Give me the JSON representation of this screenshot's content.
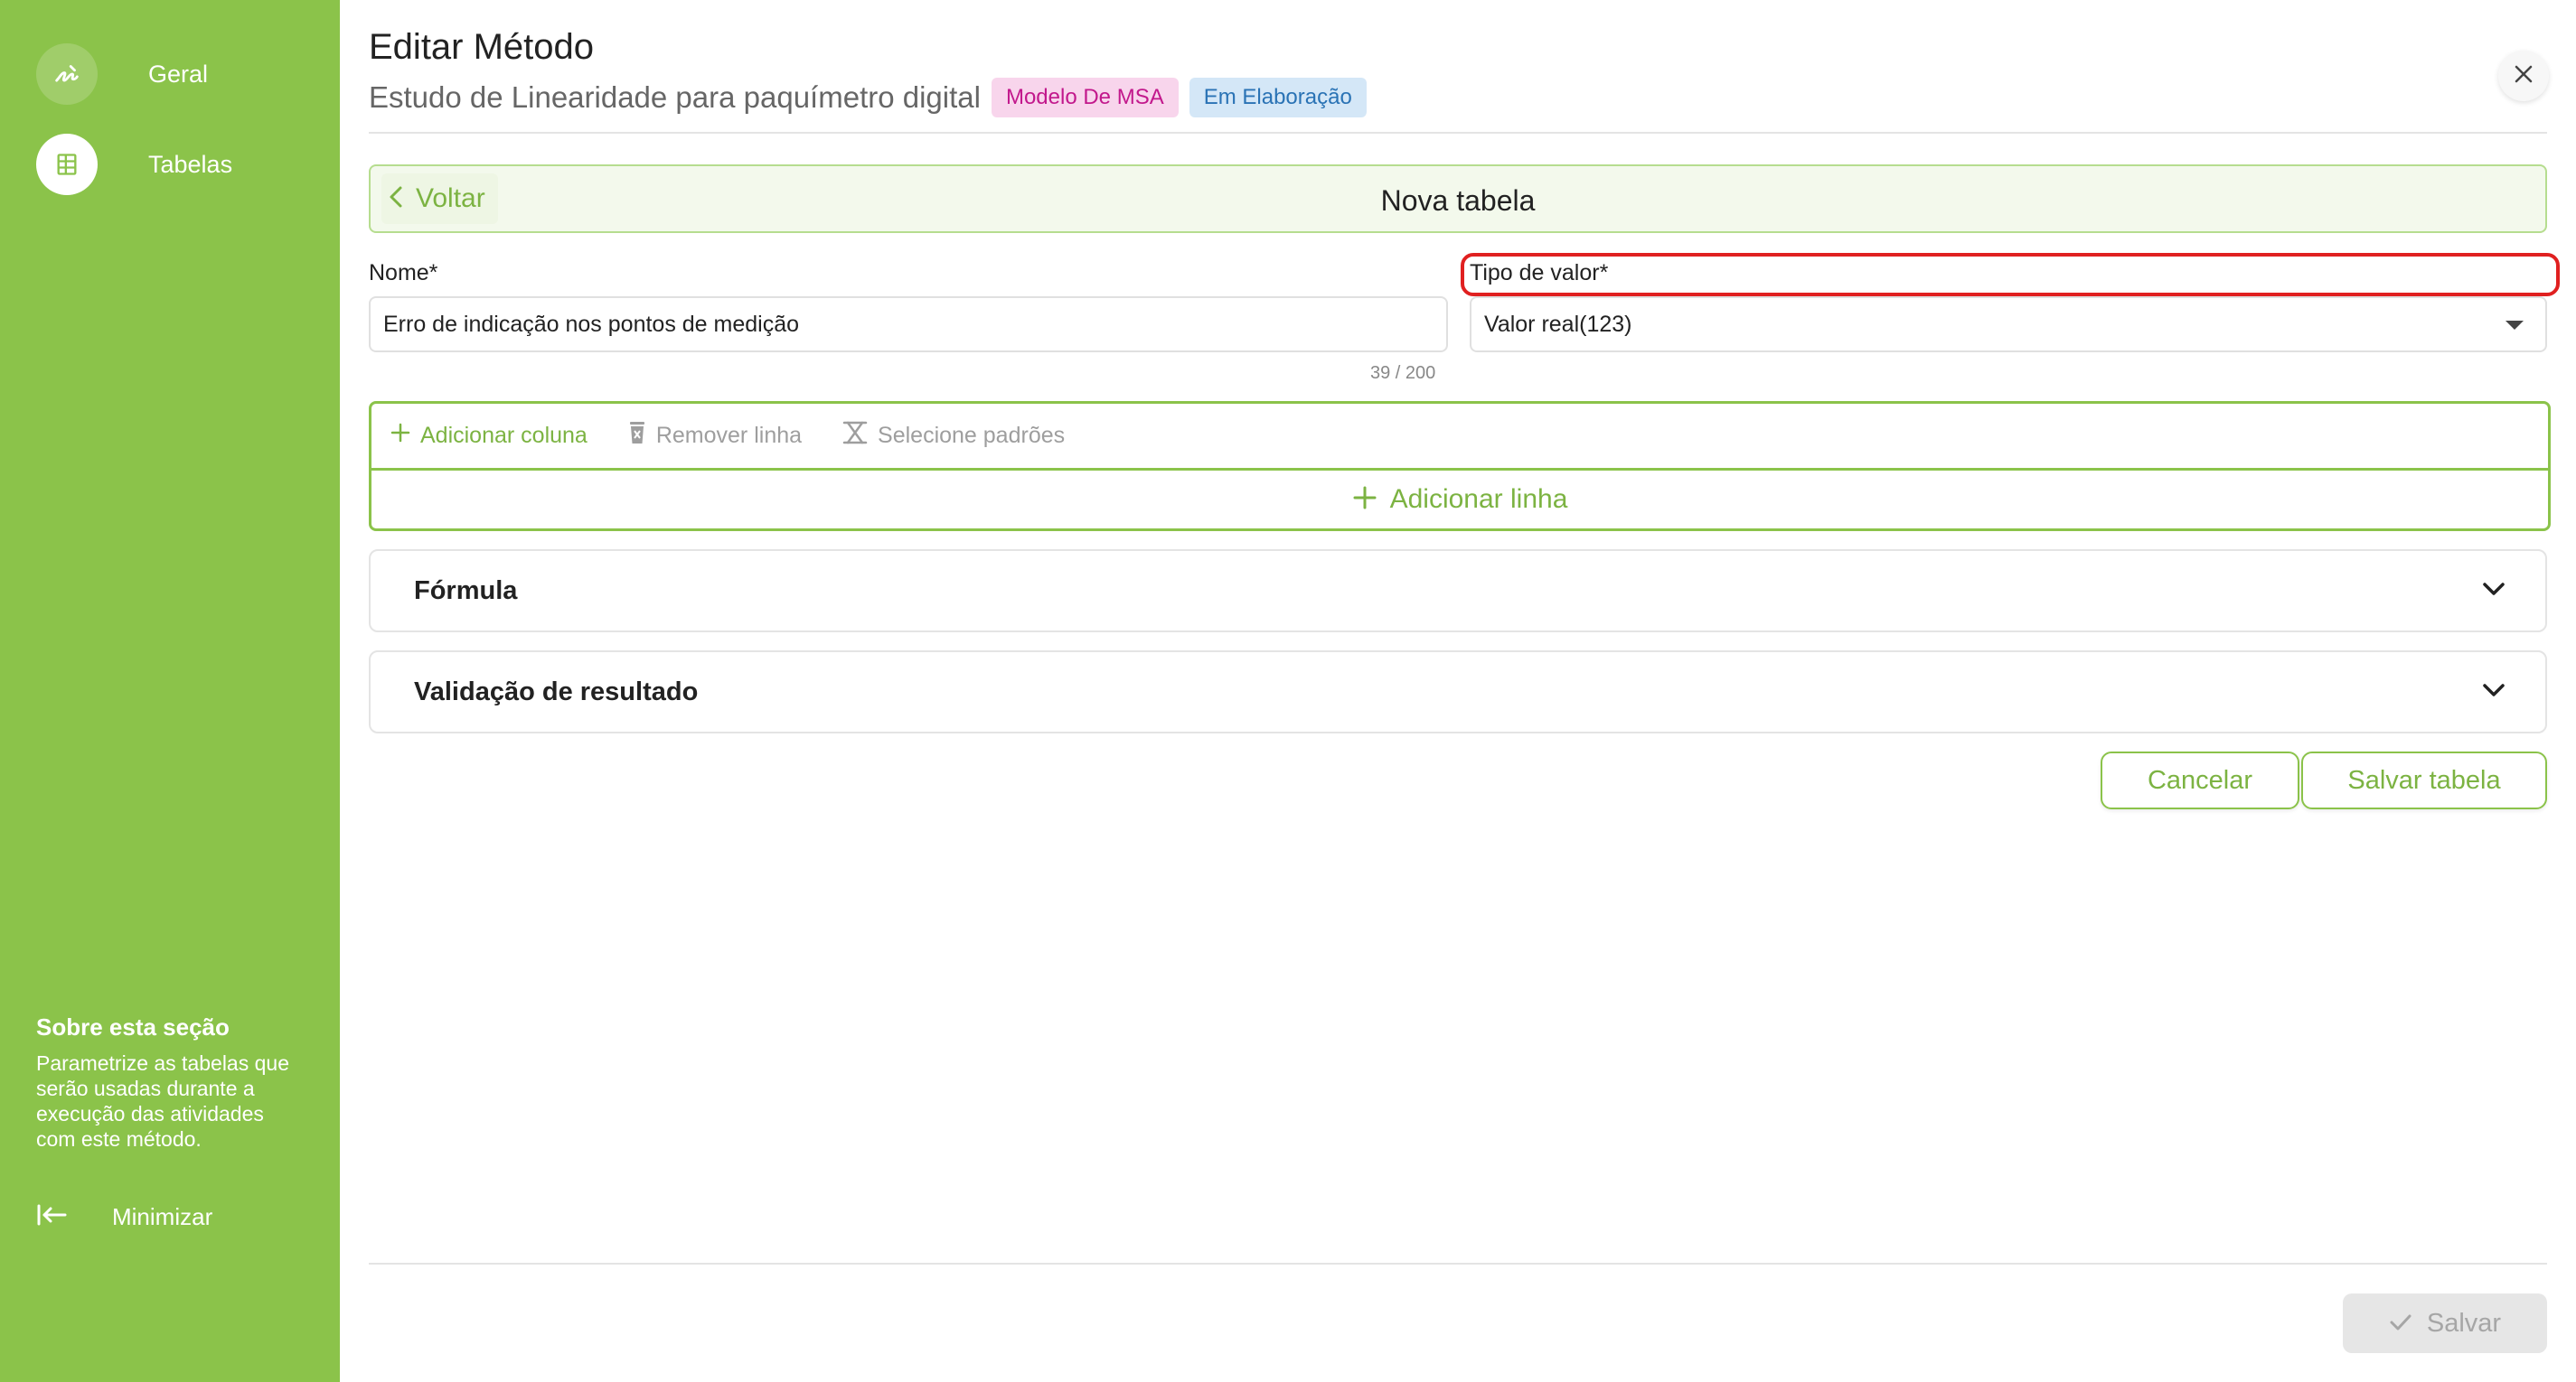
{
  "sidebar": {
    "items": [
      {
        "label": "Geral",
        "icon": "signature-icon",
        "active": false
      },
      {
        "label": "Tabelas",
        "icon": "table-list-icon",
        "active": true
      }
    ],
    "about_title": "Sobre esta seção",
    "about_text": "Parametrize as tabelas que serão usadas durante a execução das atividades com este método.",
    "minimize_label": "Minimizar"
  },
  "header": {
    "title": "Editar Método",
    "subtitle": "Estudo de Linearidade para paquímetro digital",
    "badges": [
      "Modelo De MSA",
      "Em Elaboração"
    ]
  },
  "table_editor": {
    "back_label": "Voltar",
    "title": "Nova tabela",
    "name_label": "Nome*",
    "name_value": "Erro de indicação nos pontos de medição",
    "name_counter": "39 / 200",
    "value_type_label": "Tipo de valor*",
    "value_type_selected": "Valor real(123)",
    "toolbar": {
      "add_column": "Adicionar coluna",
      "remove_row": "Remover linha",
      "select_standards": "Selecione padrões"
    },
    "add_row": "Adicionar linha",
    "sections": [
      "Fórmula",
      "Validação de resultado"
    ],
    "cancel_label": "Cancelar",
    "save_table_label": "Salvar tabela"
  },
  "footer": {
    "save_label": "Salvar"
  },
  "colors": {
    "sidebar": "#8bc34a",
    "accent": "#7cb342",
    "highlight": "#e02020"
  }
}
